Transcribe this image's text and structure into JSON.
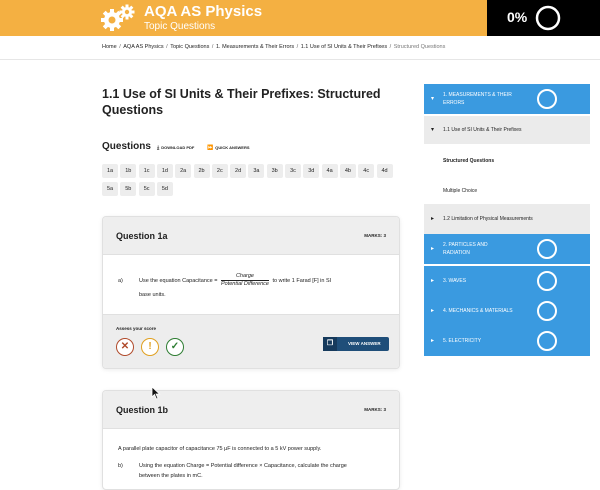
{
  "header": {
    "title": "AQA AS Physics",
    "subtitle": "Topic Questions",
    "progress": "0%",
    "progress_value": 0,
    "colors": {
      "brand": "#f4b042",
      "progress_bg": "#000000"
    }
  },
  "breadcrumb": {
    "items": [
      "Home",
      "AQA AS Physics",
      "Topic Questions",
      "1. Measurements & Their Errors",
      "1.1 Use of SI Units & Their Prefixes"
    ],
    "current": "Structured Questions"
  },
  "page": {
    "title": "1.1 Use of SI Units & Their Prefixes: Structured Questions"
  },
  "questions_section": {
    "heading": "Questions",
    "download_pdf": "DOWNLOAD PDF",
    "quick_answers": "QUICK ANSWERS",
    "numbers": [
      "1a",
      "1b",
      "1c",
      "1d",
      "2a",
      "2b",
      "2c",
      "2d",
      "3a",
      "3b",
      "3c",
      "3d",
      "4a",
      "4b",
      "4c",
      "4d",
      "5a",
      "5b",
      "5c",
      "5d"
    ]
  },
  "question_1a": {
    "title": "Question 1a",
    "marks": "MARKS: 3",
    "part": "a)",
    "text_before": "Use the equation Capacitance =",
    "fraction_num": "Charge",
    "fraction_den": "Potential Difference",
    "text_after": "to write 1 Farad [F] in SI",
    "text_line2": "base units.",
    "assess_label": "Assess your score",
    "view_answer": "VIEW ANSWER"
  },
  "question_1b": {
    "title": "Question 1b",
    "marks": "MARKS: 3",
    "intro": "A parallel plate capacitor of capacitance 75 μF is connected to a 5 kV power supply.",
    "part": "b)",
    "text_line1": "Using the equation Charge = Potential difference × Capacitance, calculate the charge",
    "text_line2": "between the plates in mC."
  },
  "sidebar": {
    "items": [
      {
        "label_line1": "1. MEASUREMENTS & THEIR",
        "label_line2": "ERRORS",
        "style": "blue",
        "arrow": "▾",
        "ring": true
      },
      {
        "label_line1": "1.1 Use of SI Units & Their Prefixes",
        "label_line2": "",
        "style": "grey",
        "arrow": "▾",
        "ring": false
      },
      {
        "label_line1": "Structured Questions",
        "label_line2": "",
        "style": "white-bold",
        "arrow": "",
        "ring": false
      },
      {
        "label_line1": "Multiple Choice",
        "label_line2": "",
        "style": "white",
        "arrow": "",
        "ring": false
      },
      {
        "label_line1": "1.2 Limitation of Physical Measurements",
        "label_line2": "",
        "style": "grey",
        "arrow": "▸",
        "ring": false
      },
      {
        "label_line1": "2. PARTICLES AND",
        "label_line2": "RADIATION",
        "style": "blue",
        "arrow": "▸",
        "ring": true
      },
      {
        "label_line1": "3. WAVES",
        "label_line2": "",
        "style": "blue",
        "arrow": "▸",
        "ring": true
      },
      {
        "label_line1": "4. MECHANICS & MATERIALS",
        "label_line2": "",
        "style": "blue",
        "arrow": "▸",
        "ring": true
      },
      {
        "label_line1": "5. ELECTRICITY",
        "label_line2": "",
        "style": "blue",
        "arrow": "▸",
        "ring": true
      }
    ],
    "colors": {
      "blue": "#3a9ae0",
      "grey": "#ebebeb"
    }
  }
}
